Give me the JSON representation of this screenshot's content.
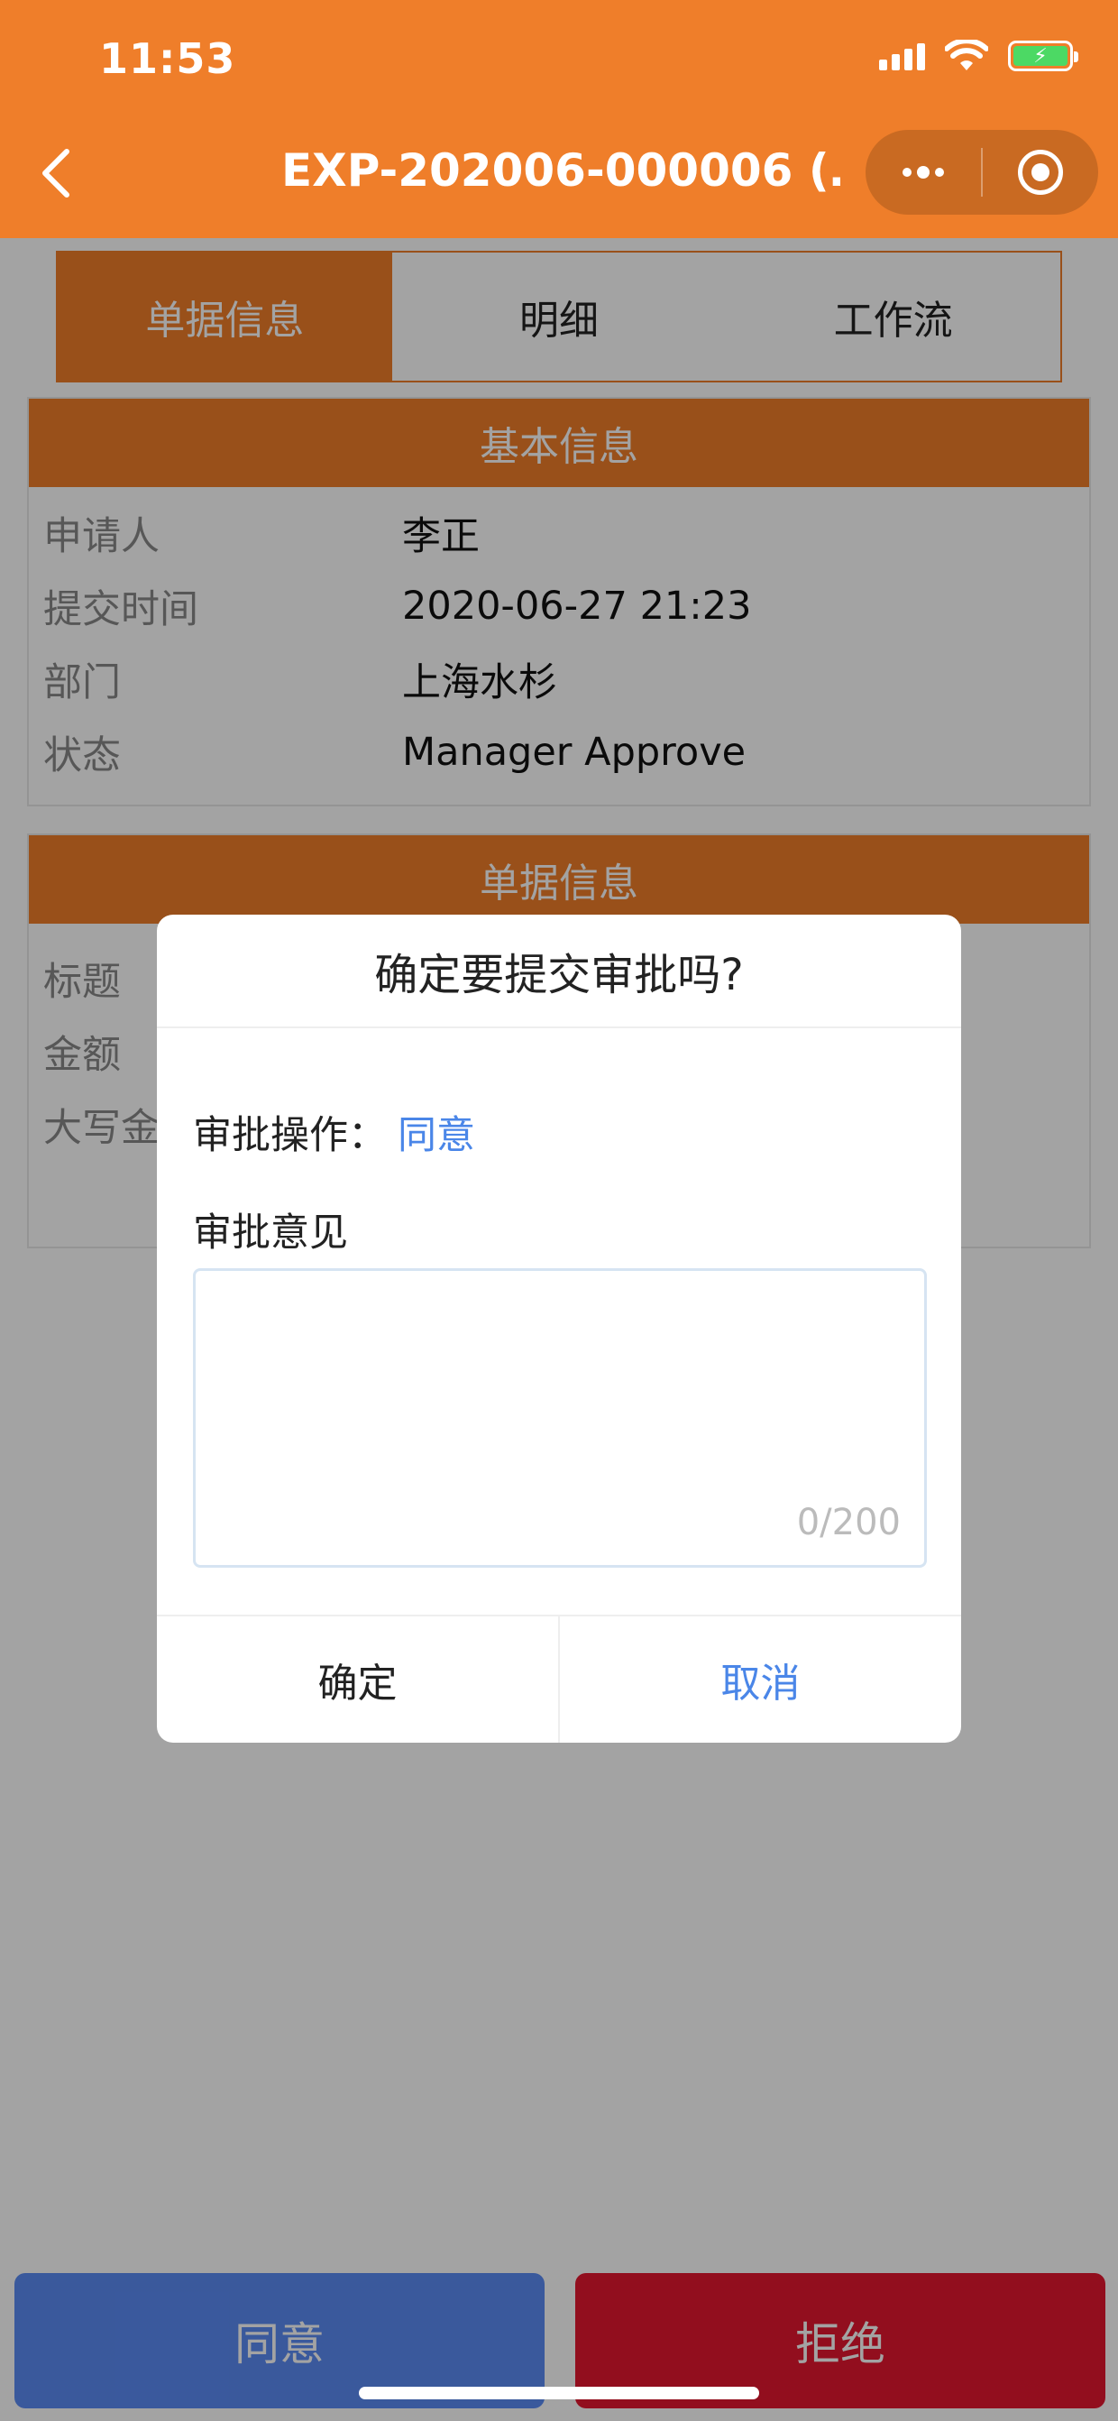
{
  "status_bar": {
    "time": "11:53"
  },
  "nav": {
    "title": "EXP-202006-000006 (…"
  },
  "tabs": [
    {
      "label": "单据信息",
      "active": true
    },
    {
      "label": "明细",
      "active": false
    },
    {
      "label": "工作流",
      "active": false
    }
  ],
  "basic_info": {
    "header": "基本信息",
    "rows": [
      {
        "key": "申请人",
        "value": "李正"
      },
      {
        "key": "提交时间",
        "value": "2020-06-27 21:23"
      },
      {
        "key": "部门",
        "value": "上海水杉"
      },
      {
        "key": "状态",
        "value": "Manager Approve"
      }
    ]
  },
  "doc_info": {
    "header": "单据信息",
    "rows": [
      {
        "key": "标题",
        "value": ""
      },
      {
        "key": "金额",
        "value": ""
      },
      {
        "key": "大写金",
        "value": ""
      }
    ]
  },
  "dialog": {
    "title": "确定要提交审批吗?",
    "operation_label": "审批操作：",
    "operation_value": "同意",
    "comment_label": "审批意见",
    "counter": "0/200",
    "confirm_label": "确定",
    "cancel_label": "取消"
  },
  "bottom_buttons": {
    "agree": "同意",
    "reject": "拒绝"
  },
  "colors": {
    "brand": "#ef7e2a",
    "agree": "#5b8cf5",
    "reject": "#e4162f",
    "link": "#4a86e8"
  }
}
